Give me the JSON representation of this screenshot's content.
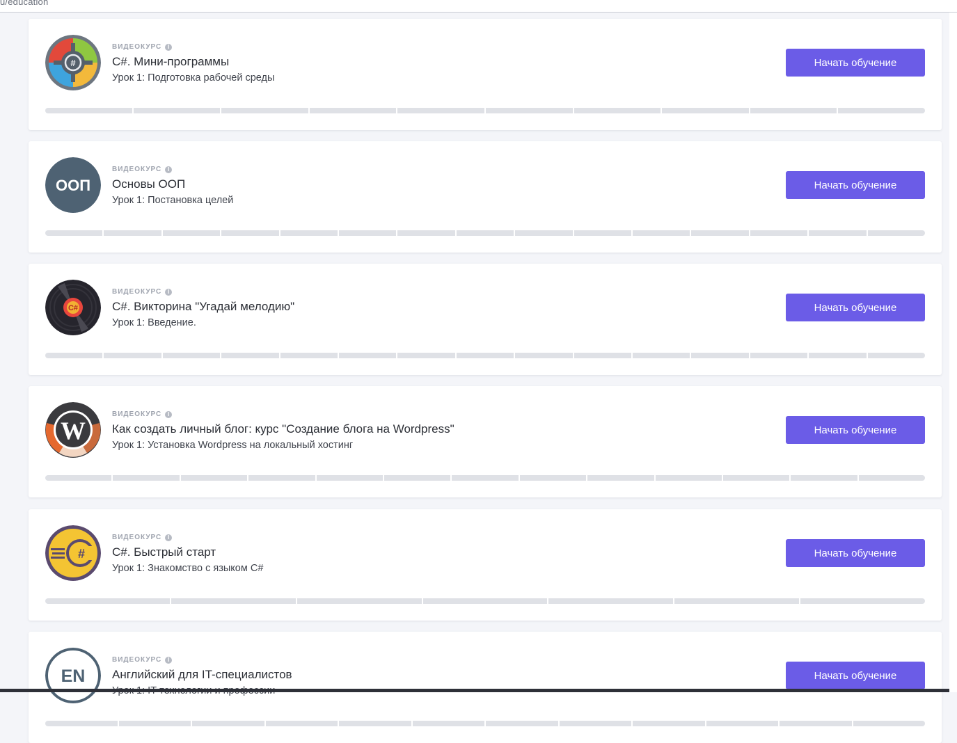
{
  "address_bar": {
    "url_text": "u/education"
  },
  "courses": [
    {
      "tag": "видеокурс",
      "title": "C#. Мини-программы",
      "lesson": "Урок 1: Подготовка рабочей среды",
      "button": "Начать обучение",
      "progress_segments": 10,
      "icon": "csharp-mini-programs-icon"
    },
    {
      "tag": "видеокурс",
      "title": "Основы ООП",
      "lesson": "Урок 1: Постановка целей",
      "button": "Начать обучение",
      "progress_segments": 15,
      "icon": "oop-icon",
      "icon_text": "ООП"
    },
    {
      "tag": "видеокурс",
      "title": "C#. Викторина \"Угадай мелодию\"",
      "lesson": "Урок 1: Введение.",
      "button": "Начать обучение",
      "progress_segments": 15,
      "icon": "vinyl-record-icon"
    },
    {
      "tag": "видеокурс",
      "title": "Как создать личный блог: курс \"Создание блога на Wordpress\"",
      "lesson": "Урок 1: Установка Wordpress на локальный хостинг",
      "button": "Начать обучение",
      "progress_segments": 13,
      "icon": "wordpress-icon"
    },
    {
      "tag": "видеокурс",
      "title": "C#. Быстрый старт",
      "lesson": "Урок 1: Знакомство с языком C#",
      "button": "Начать обучение",
      "progress_segments": 7,
      "icon": "csharp-fast-start-icon"
    },
    {
      "tag": "видеокурс",
      "title": "Английский для IT-специалистов",
      "lesson": "Урок 1: IT-технологии и профессии",
      "button": "Начать обучение",
      "progress_segments": 12,
      "icon": "english-en-icon",
      "icon_text": "EN"
    }
  ],
  "colors": {
    "accent": "#6b5ce7",
    "page_background": "#f4f5f9",
    "progress_track": "#dfe1e6"
  }
}
